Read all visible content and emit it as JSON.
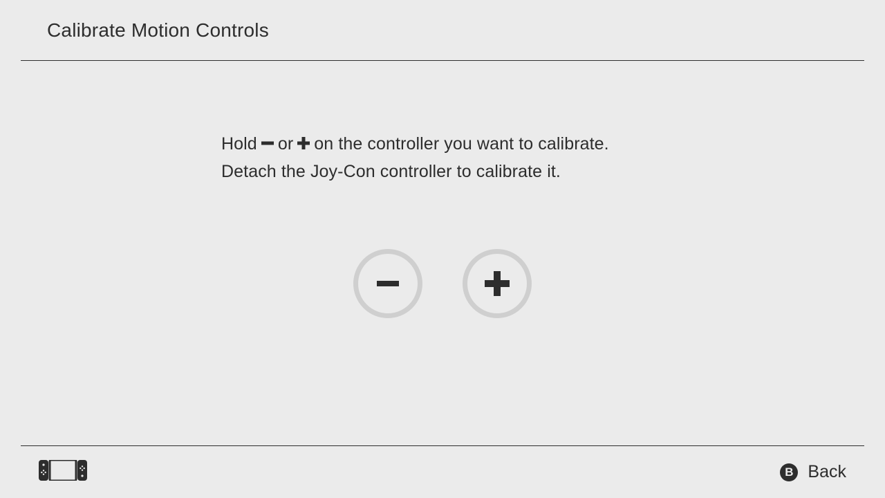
{
  "header": {
    "title": "Calibrate Motion Controls"
  },
  "instructions": {
    "line1_pre": "Hold ",
    "line1_mid": " or ",
    "line1_post": " on the controller you want to calibrate.",
    "line2": "Detach the Joy-Con controller to calibrate it."
  },
  "footer": {
    "back_button_glyph": "B",
    "back_label": "Back"
  }
}
